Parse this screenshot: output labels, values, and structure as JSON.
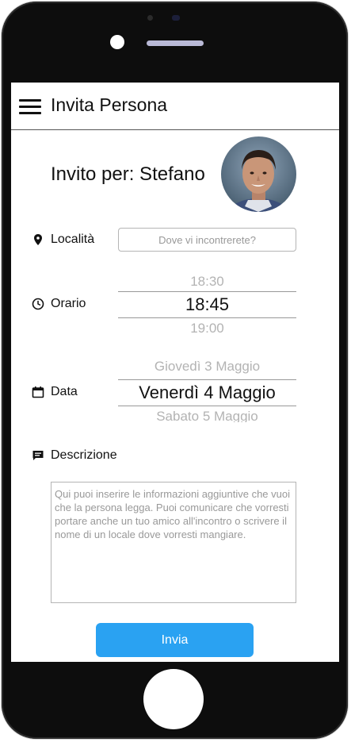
{
  "header": {
    "title": "Invita Persona",
    "menu_icon": "hamburger-menu-icon"
  },
  "invite": {
    "text": "Invito per: Stefano"
  },
  "location": {
    "icon": "map-pin-icon",
    "label": "Località",
    "placeholder": "Dove vi incontrerete?"
  },
  "time": {
    "icon": "clock-icon",
    "label": "Orario",
    "previous": "18:30",
    "selected": "18:45",
    "next": "19:00"
  },
  "date": {
    "icon": "calendar-icon",
    "label": "Data",
    "previous": "Giovedì 3 Maggio",
    "selected": "Venerdì 4 Maggio",
    "next": "Sabato 5 Maggio"
  },
  "description": {
    "icon": "comment-icon",
    "label": "Descrizione",
    "placeholder": "Qui puoi inserire le informazioni aggiuntive che vuoi che la persona legga. Puoi comunicare che vorresti portare anche un tuo amico all'incontro o scrivere il nome di un locale dove vorresti mangiare."
  },
  "actions": {
    "send_label": "Invia"
  },
  "colors": {
    "accent": "#2aa2f2",
    "phone_frame": "#0d0d0d"
  }
}
